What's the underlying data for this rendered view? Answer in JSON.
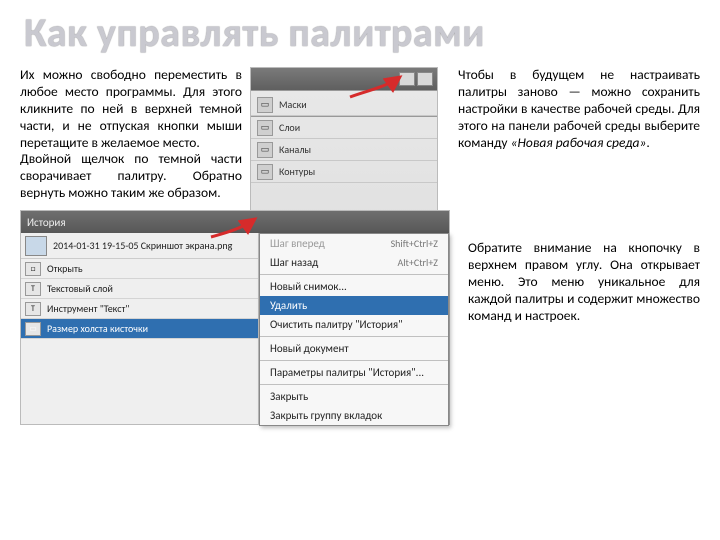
{
  "title": "Как управлять палитрами",
  "para1": "Их можно свободно переместить в любое место программы. Для этого кликните по ней в верхней темной части, и не отпуская кнопки мыши перетащите в желаемое место.",
  "para2": "Двойной щелчок по темной части сворачивает палитру. Обратно вернуть можно таким же образом.",
  "para3a": "Чтобы в будущем не настраивать палитры заново — можно сохранить настройки в качестве рабочей среды. Для этого на панели рабочей среды выберите команду ",
  "para3b": "«Новая рабочая среда»",
  "para3c": ".",
  "para4": "Обратите внимание на кнопочку в верхнем правом углу. Она открывает меню. Это меню уникальное для каждой палитры и содержит множество команд и настроек.",
  "palettes": {
    "items": [
      "Маски",
      "Слои",
      "Каналы",
      "Контуры"
    ]
  },
  "history": {
    "tab": "История",
    "filename": "2014-01-31 19-15-05 Скриншот экрана.png",
    "rows": [
      {
        "label": "Открыть",
        "sel": false,
        "icon": "□"
      },
      {
        "label": "Текстовый слой",
        "sel": false,
        "icon": "T"
      },
      {
        "label": "Инструмент \"Текст\"",
        "sel": false,
        "icon": "T"
      },
      {
        "label": "Размер холста кисточки",
        "sel": true,
        "icon": "▭"
      }
    ],
    "menu": [
      {
        "label": "Шаг вперед",
        "shortcut": "Shift+Ctrl+Z",
        "type": "item",
        "state": "disabled"
      },
      {
        "label": "Шаг назад",
        "shortcut": "Alt+Ctrl+Z",
        "type": "item",
        "state": ""
      },
      {
        "type": "sep"
      },
      {
        "label": "Новый снимок...",
        "type": "item",
        "state": ""
      },
      {
        "label": "Удалить",
        "type": "item",
        "state": "sel"
      },
      {
        "label": "Очистить палитру \"История\"",
        "type": "item",
        "state": ""
      },
      {
        "type": "sep"
      },
      {
        "label": "Новый документ",
        "type": "item",
        "state": ""
      },
      {
        "type": "sep"
      },
      {
        "label": "Параметры палитры \"История\"...",
        "type": "item",
        "state": ""
      },
      {
        "type": "sep"
      },
      {
        "label": "Закрыть",
        "type": "item",
        "state": ""
      },
      {
        "label": "Закрыть группу вкладок",
        "type": "item",
        "state": ""
      }
    ]
  }
}
